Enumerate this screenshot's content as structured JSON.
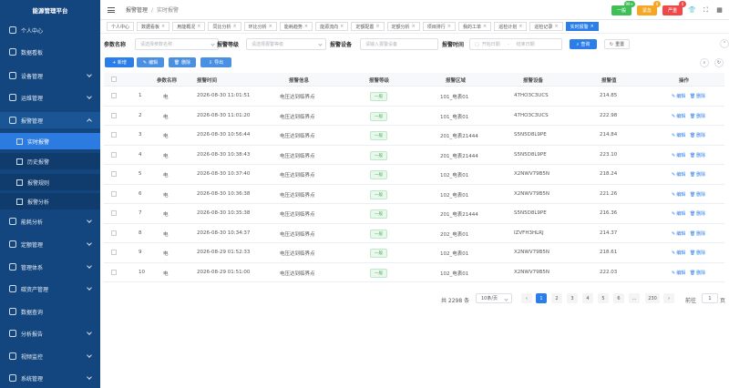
{
  "app": {
    "title": "能源管理平台"
  },
  "sidebar": {
    "items": [
      {
        "label": "个人中心",
        "icon": "user-icon"
      },
      {
        "label": "数据看板",
        "icon": "dashboard-icon"
      },
      {
        "label": "设备管理",
        "icon": "device-icon"
      },
      {
        "label": "运维管理",
        "icon": "tool-icon"
      },
      {
        "label": "报警管理",
        "icon": "alarm-icon"
      },
      {
        "label": "能耗分析",
        "icon": "chart-icon"
      },
      {
        "label": "定额管理",
        "icon": "quota-icon"
      },
      {
        "label": "管理体系",
        "icon": "system-icon"
      },
      {
        "label": "碳资产管理",
        "icon": "carbon-icon"
      },
      {
        "label": "数据查询",
        "icon": "query-icon"
      },
      {
        "label": "分析报告",
        "icon": "report-icon"
      },
      {
        "label": "视频监控",
        "icon": "video-icon"
      },
      {
        "label": "系统管理",
        "icon": "gear-icon"
      }
    ],
    "sub_items": [
      {
        "label": "实时报警"
      },
      {
        "label": "历史报警"
      },
      {
        "label": "报警规则"
      },
      {
        "label": "报警分析"
      }
    ]
  },
  "header": {
    "breadcrumb": [
      "报警管理",
      "实时报警"
    ],
    "buttons": [
      {
        "label": "一般",
        "badge": "99+",
        "color": "#3fbf55",
        "badge_color": "#3fbf55"
      },
      {
        "label": "紧急",
        "badge": "0",
        "color": "#f5a623",
        "badge_color": "#f5a623"
      },
      {
        "label": "严重",
        "badge": "0",
        "color": "#f04848",
        "badge_color": "#f04848"
      }
    ]
  },
  "tabs": [
    {
      "label": "个人中心"
    },
    {
      "label": "数据看板"
    },
    {
      "label": "用能概况"
    },
    {
      "label": "同比分析"
    },
    {
      "label": "环比分析"
    },
    {
      "label": "能耗趋势"
    },
    {
      "label": "能源流向"
    },
    {
      "label": "定额配置"
    },
    {
      "label": "定额分析"
    },
    {
      "label": "项目排行"
    },
    {
      "label": "我的工单"
    },
    {
      "label": "巡检计划"
    },
    {
      "label": "巡检记录"
    },
    {
      "label": "实时报警"
    }
  ],
  "filter": {
    "param_label": "参数名称",
    "param_placeholder": "请选择参数名称",
    "level_label": "报警等级",
    "level_placeholder": "请选择报警等级",
    "device_label": "报警设备",
    "device_placeholder": "请输入报警设备",
    "time_label": "报警时间",
    "start_placeholder": "开始日期",
    "dash": "-",
    "end_placeholder": "结束日期",
    "search_label": "查询",
    "reset_label": "重置"
  },
  "actions": {
    "add": "+ 新增",
    "edit": "编辑",
    "delete": "删除",
    "export": "导出"
  },
  "table": {
    "headers": [
      "参数名称",
      "报警时间",
      "报警信息",
      "报警等级",
      "报警区域",
      "报警设备",
      "报警值",
      "操作"
    ],
    "rows": [
      {
        "index": "1",
        "param": "电",
        "time": "2026-08-30 11:01:51",
        "info": "电压达到临界点",
        "level": "一般",
        "area": "101_电表01",
        "device": "47HO3C3UCS",
        "value": "214.85"
      },
      {
        "index": "2",
        "param": "电",
        "time": "2026-08-30 11:01:20",
        "info": "电压达到临界点",
        "level": "一般",
        "area": "101_电表01",
        "device": "47HO3C3UCS",
        "value": "222.98"
      },
      {
        "index": "3",
        "param": "电",
        "time": "2026-08-30 10:56:44",
        "info": "电压达到临界点",
        "level": "一般",
        "area": "201_电表21444",
        "device": "S5N5D8L9PE",
        "value": "214.84"
      },
      {
        "index": "4",
        "param": "电",
        "time": "2026-08-30 10:38:43",
        "info": "电压达到临界点",
        "level": "一般",
        "area": "201_电表21444",
        "device": "S5N5D8L9PE",
        "value": "223.10"
      },
      {
        "index": "5",
        "param": "电",
        "time": "2026-08-30 10:37:40",
        "info": "电压达到临界点",
        "level": "一般",
        "area": "102_电表01",
        "device": "X2NWV79B5N",
        "value": "218.24"
      },
      {
        "index": "6",
        "param": "电",
        "time": "2026-08-30 10:36:38",
        "info": "电压达到临界点",
        "level": "一般",
        "area": "102_电表01",
        "device": "X2NWV79B5N",
        "value": "221.26"
      },
      {
        "index": "7",
        "param": "电",
        "time": "2026-08-30 10:35:38",
        "info": "电压达到临界点",
        "level": "一般",
        "area": "201_电表21444",
        "device": "S5N5D8L9PE",
        "value": "216.36"
      },
      {
        "index": "8",
        "param": "电",
        "time": "2026-08-30 10:34:37",
        "info": "电压达到临界点",
        "level": "一般",
        "area": "202_电表01",
        "device": "IZVFH3HLRJ",
        "value": "214.37"
      },
      {
        "index": "9",
        "param": "电",
        "time": "2026-08-29 01:52:33",
        "info": "电压达到临界点",
        "level": "一般",
        "area": "102_电表01",
        "device": "X2NWV79B5N",
        "value": "218.61"
      },
      {
        "index": "10",
        "param": "电",
        "time": "2026-08-29 01:51:00",
        "info": "电压达到临界点",
        "level": "一般",
        "area": "102_电表01",
        "device": "X2NWV79B5N",
        "value": "222.03"
      }
    ],
    "op_edit": "编辑",
    "op_delete": "删除"
  },
  "pagination": {
    "total": "共 2298 条",
    "page_size": "10条/页",
    "pages": [
      "1",
      "2",
      "3",
      "4",
      "5",
      "6",
      "...",
      "230"
    ],
    "current": "1",
    "goto_label": "前往",
    "goto_value": "1",
    "goto_suffix": "页"
  }
}
